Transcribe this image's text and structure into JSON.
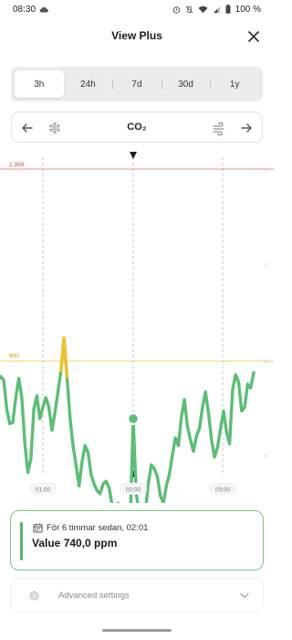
{
  "status": {
    "time": "08:30",
    "battery": "100 %",
    "icons": [
      "cloud-icon",
      "alarm-icon",
      "vibrate-off-icon",
      "wifi-icon",
      "signal-icon",
      "battery-icon"
    ]
  },
  "header": {
    "title": "View Plus",
    "close_icon": "close-icon"
  },
  "range_tabs": {
    "items": [
      "3h",
      "24h",
      "7d",
      "30d",
      "1y"
    ],
    "selected": "3h"
  },
  "sensor": {
    "name": "CO₂",
    "prev_icon": "arrow-left-icon",
    "next_icon": "arrow-right-icon",
    "left_icon": "sensor-dots-icon",
    "right_icon": "airflow-icon"
  },
  "chart": {
    "threshold_high_label": "1 000",
    "threshold_low_label": "800",
    "x_ticks": [
      "01:00",
      "02:00",
      "03:00"
    ],
    "line_color": "#5dbd76",
    "warning_color": "#f0c02e",
    "high_line_color": "#e08f8f",
    "low_line_color": "#f4d36a"
  },
  "info_card": {
    "time_text": "För 6 timmar sedan, 02:01",
    "value_text": "Value 740,0 ppm",
    "icon": "calendar-icon"
  },
  "advanced": {
    "label": "Advanced settings",
    "icon": "gear-icon",
    "chevron": "chevron-down-icon"
  },
  "chart_data": {
    "type": "line",
    "title": "",
    "xlabel": "",
    "ylabel": "",
    "x_ticks": [
      "01:00",
      "02:00",
      "03:00"
    ],
    "ylim": [
      520,
      1140
    ],
    "thresholds": [
      {
        "label": "1 000",
        "value": 1000,
        "color": "#e08f8f"
      },
      {
        "label": "800",
        "value": 800,
        "color": "#f4d36a"
      }
    ],
    "series": [
      {
        "x": [
          "00:28",
          "00:30",
          "00:32",
          "00:34",
          "00:36",
          "00:38",
          "00:40",
          "00:42",
          "00:44",
          "00:46",
          "00:48",
          "00:50",
          "00:52",
          "00:54",
          "00:56",
          "00:58",
          "01:00",
          "01:02",
          "01:04",
          "01:06",
          "01:08",
          "01:10",
          "01:12",
          "01:14",
          "01:16",
          "01:18",
          "01:20",
          "01:22",
          "01:24",
          "01:26",
          "01:28",
          "01:30",
          "01:32",
          "01:34",
          "01:36",
          "01:38",
          "01:40",
          "01:42",
          "01:44",
          "01:46",
          "01:48",
          "01:50",
          "01:52",
          "01:54",
          "01:56",
          "01:58",
          "02:00",
          "02:02",
          "02:04",
          "02:06",
          "02:08",
          "02:10",
          "02:12",
          "02:14",
          "02:16",
          "02:18",
          "02:20",
          "02:22",
          "02:24",
          "02:26",
          "02:28",
          "02:30",
          "02:32",
          "02:34",
          "02:36",
          "02:38",
          "02:40",
          "02:42",
          "02:44",
          "02:46",
          "02:48",
          "02:50",
          "02:52",
          "02:54",
          "02:56",
          "02:58",
          "03:00",
          "03:02",
          "03:04",
          "03:06",
          "03:08",
          "03:10",
          "03:12",
          "03:14",
          "03:16",
          "03:18",
          "03:20"
        ],
        "y": [
          780,
          780,
          784,
          780,
          750,
          735,
          736,
          762,
          782,
          762,
          715,
          684,
          698,
          750,
          764,
          740,
          752,
          762,
          752,
          728,
          746,
          768,
          790,
          824,
          784,
          742,
          712,
          692,
          670,
          695,
          712,
          705,
          682,
          672,
          665,
          662,
          672,
          675,
          668,
          650,
          640,
          652,
          650,
          622,
          618,
          632,
          740,
          662,
          642,
          630,
          642,
          672,
          692,
          688,
          680,
          660,
          652,
          670,
          682,
          702,
          720,
          712,
          742,
          760,
          732,
          718,
          706,
          722,
          730,
          752,
          768,
          746,
          718,
          700,
          710,
          730,
          748,
          726,
          714,
          770,
          786,
          778,
          748,
          752,
          776,
          772,
          788
        ]
      }
    ]
  }
}
